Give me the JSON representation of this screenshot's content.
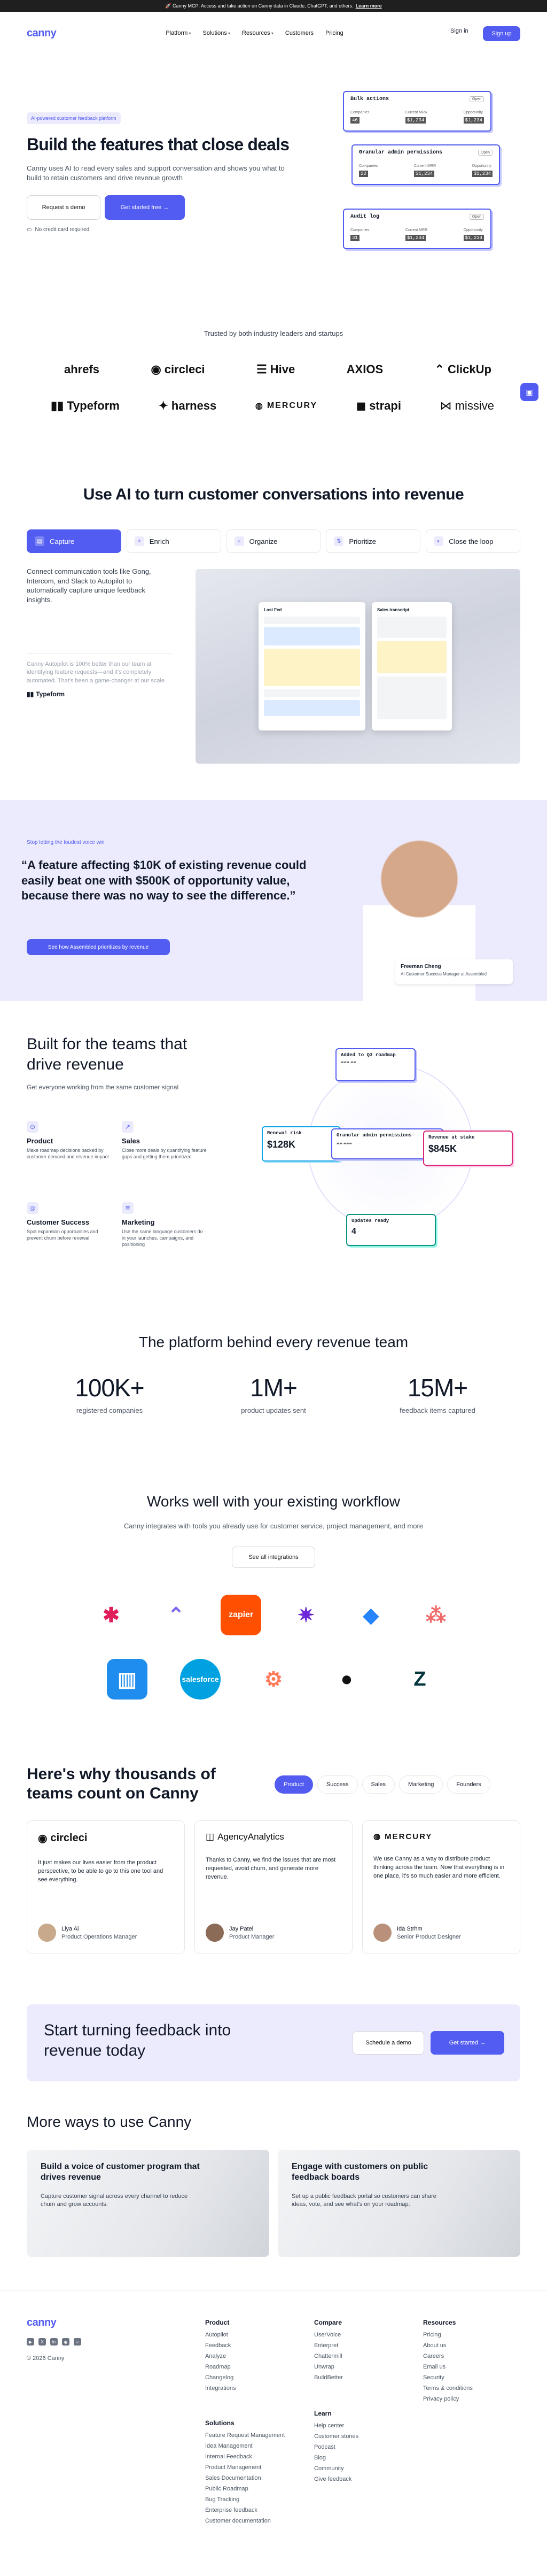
{
  "announcement": {
    "text": "🚀 Canny MCP: Access and take action on Canny data in Claude, ChatGPT, and others.",
    "link": "Learn more"
  },
  "nav": {
    "logo": "canny",
    "links": [
      "Platform",
      "Solutions",
      "Resources",
      "Customers",
      "Pricing"
    ],
    "login": "Sign in",
    "signup": "Sign up"
  },
  "hero": {
    "badge": "AI-powered customer feedback platform",
    "title": "Build the features that close deals",
    "subtitle": "Canny uses AI to read every sales and support conversation and shows you what to build to retain customers and drive revenue growth",
    "demo_button": "Request a demo",
    "start_button": "Get started free →",
    "note": "No credit card required",
    "cards": [
      {
        "title": "Bulk actions",
        "chip": "Open",
        "cols": [
          "Companies",
          "Current MRR",
          "Opportunity"
        ],
        "vals": [
          "46",
          "$1,234",
          "$1,234"
        ]
      },
      {
        "title": "Granular admin permissions",
        "chip": "Open",
        "cols": [
          "Companies",
          "Current MRR",
          "Opportunity"
        ],
        "vals": [
          "22",
          "$1,234",
          "$1,234"
        ]
      },
      {
        "title": "Audit log",
        "chip": "Open",
        "cols": [
          "Companies",
          "Current MRR",
          "Opportunity"
        ],
        "vals": [
          "31",
          "$1,234",
          "$1,234"
        ]
      }
    ]
  },
  "logos": {
    "heading": "Trusted by both industry leaders and startups",
    "row1": [
      "ahrefs",
      "circleci",
      "Hive",
      "AXIOS",
      "ClickUp"
    ],
    "row2": [
      "Typeform",
      "harness",
      "MERCURY",
      "strapi",
      "missive"
    ]
  },
  "ai_section": {
    "title": "Use AI to turn customer conversations into revenue",
    "tabs": [
      "Capture",
      "Enrich",
      "Organize",
      "Prioritize",
      "Close the loop"
    ],
    "active_text": "Connect communication tools like Gong, Intercom, and Slack to Autopilot to automatically capture unique feedback insights.",
    "quote": "Canny Autopilot is 100% better than our team at identifying feature requests—and it's completely automated. That's been a game-changer at our scale.",
    "quote_brand": "Typeform",
    "mock_left_title": "Lost Fed",
    "mock_right_title": "Sales transcript"
  },
  "testimonial_big": {
    "eyebrow": "Stop letting the loudest voice win",
    "quote": "“A feature affecting $10K of existing revenue could easily beat one with $500K of opportunity value, because there was no way to see the difference.”",
    "button": "See how Assembled prioritizes by revenue",
    "name": "Freeman Cheng",
    "role": "AI Customer Success Manager at Assembled"
  },
  "teams": {
    "title": "Built for the teams that drive revenue",
    "subtitle": "Get everyone working from the same customer signal",
    "items": [
      {
        "name": "Product",
        "desc": "Make roadmap decisions backed by customer demand and revenue impact"
      },
      {
        "name": "Sales",
        "desc": "Close more deals by quantifying feature gaps and getting them prioritized"
      },
      {
        "name": "Customer Success",
        "desc": "Spot expansion opportunities and prevent churn before renewal"
      },
      {
        "name": "Marketing",
        "desc": "Use the same language customers do in your launches, campaigns, and positioning"
      }
    ],
    "diagram": {
      "added": "Added to Q3 roadmap",
      "renewal": "Renewal risk",
      "renewal_val": "$128K",
      "admin": "Granular admin permissions",
      "revenue": "Revenue at stake",
      "revenue_val": "$845K",
      "updates": "Updates ready",
      "updates_val": "4"
    }
  },
  "stats": {
    "title": "The platform behind every revenue team",
    "items": [
      {
        "value": "100K+",
        "label": "registered companies"
      },
      {
        "value": "1M+",
        "label": "product updates sent"
      },
      {
        "value": "15M+",
        "label": "feedback items captured"
      }
    ]
  },
  "integrations": {
    "title": "Works well with your existing workflow",
    "subtitle": "Canny integrates with tools you already use for customer service, project management, and more",
    "button": "See all integrations",
    "apps": [
      "slack-icon",
      "clickup-icon",
      "zapier-icon",
      "bolt-icon",
      "jira-icon",
      "asana-icon",
      "intercom-icon",
      "salesforce-icon",
      "hubspot-icon",
      "github-icon",
      "zendesk-icon"
    ],
    "zapier_label": "zapier",
    "salesforce_label": "salesforce"
  },
  "why": {
    "title": "Here's why thousands of teams count on Canny",
    "tabs": [
      "Product",
      "Success",
      "Sales",
      "Marketing",
      "Founders"
    ],
    "cards": [
      {
        "brand": "circleci",
        "quote": "It just makes our lives easier from the product perspective, to be able to go to this one tool and see everything.",
        "name": "Liya Ai",
        "role": "Product Operations Manager"
      },
      {
        "brand": "AgencyAnalytics",
        "quote": "Thanks to Canny, we find the issues that are most requested, avoid churn, and generate more revenue.",
        "name": "Jay Patel",
        "role": "Product Manager"
      },
      {
        "brand": "MERCURY",
        "quote": "We use Canny as a way to distribute product thinking across the team. Now that everything is in one place, it's so much easier and more efficient.",
        "name": "Ida Strhm",
        "role": "Senior Product Designer"
      }
    ]
  },
  "cta": {
    "title": "Start turning feedback into revenue today",
    "demo": "Schedule a demo",
    "start": "Get started →"
  },
  "more": {
    "title": "More ways to use Canny",
    "cards": [
      {
        "title": "Build a voice of customer program that drives revenue",
        "desc": "Capture customer signal across every channel to reduce churn and grow accounts."
      },
      {
        "title": "Engage with customers on public feedback boards",
        "desc": "Set up a public feedback portal so customers can share ideas, vote, and see what's on your roadmap."
      }
    ]
  },
  "footer": {
    "logo": "canny",
    "copyright": "© 2026 Canny",
    "cols": [
      {
        "title": "Product",
        "items": [
          "Autopilot",
          "Feedback",
          "Analyze",
          "Roadmap",
          "Changelog",
          "Integrations"
        ]
      },
      {
        "title": "Compare",
        "items": [
          "UserVoice",
          "Enterpret",
          "Chattermill",
          "Unwrap",
          "BuildBetter"
        ]
      },
      {
        "title": "Resources",
        "items": [
          "Pricing",
          "About us",
          "Careers",
          "Email us",
          "Security",
          "Terms & conditions",
          "Privacy policy"
        ]
      },
      {
        "title": "Solutions",
        "items": [
          "Feature Request Management",
          "Idea Management",
          "Internal Feedback",
          "Product Management",
          "Sales Documentation",
          "Public Roadmap",
          "Bug Tracking",
          "Enterprise feedback",
          "Customer documentation"
        ]
      },
      {
        "title": "Learn",
        "items": [
          "Help center",
          "Customer stories",
          "Podcast",
          "Blog",
          "Community",
          "Give feedback"
        ]
      }
    ]
  },
  "colors": {
    "brand": "#525cf0",
    "soft": "#ecebfd"
  }
}
